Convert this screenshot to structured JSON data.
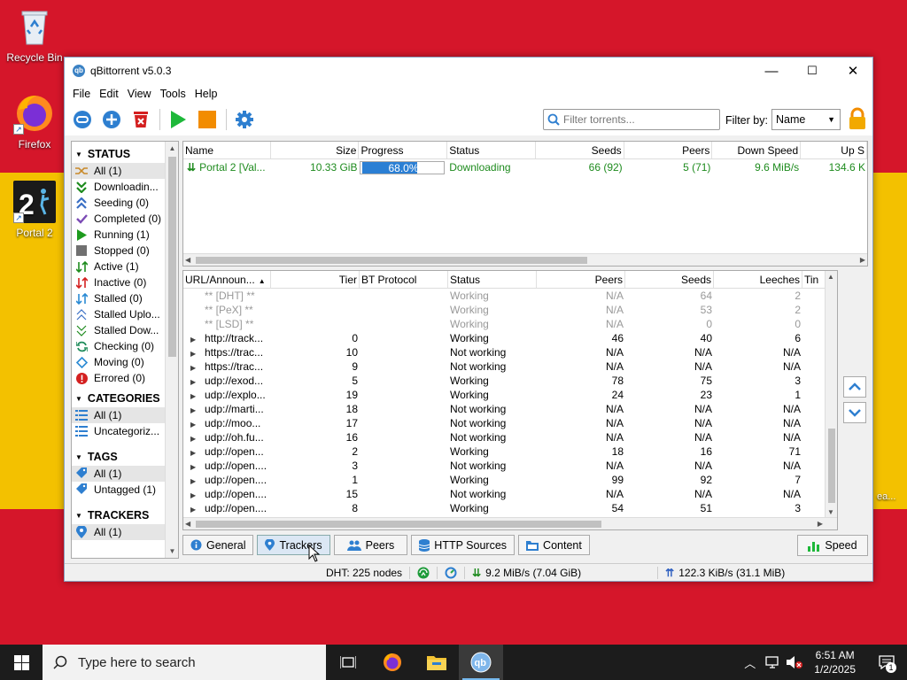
{
  "desktop": {
    "icons": [
      {
        "label": "Recycle Bin"
      },
      {
        "label": "Firefox"
      },
      {
        "label": "Portal 2"
      }
    ],
    "partial_text": "ea..."
  },
  "window": {
    "title": "qBittorrent v5.0.3",
    "controls": {
      "minimize": "—",
      "maximize": "☐",
      "close": "✕"
    }
  },
  "menu": [
    "File",
    "Edit",
    "View",
    "Tools",
    "Help"
  ],
  "toolbar": {
    "search_placeholder": "Filter torrents...",
    "filter_label": "Filter by:",
    "filter_value": "Name"
  },
  "sidebar": {
    "status": {
      "title": "STATUS",
      "items": [
        {
          "label": "All (1)",
          "icon": "shuffle-icon",
          "color": "#c98a2a"
        },
        {
          "label": "Downloadin...",
          "icon": "download-icon",
          "color": "#1e8b1e"
        },
        {
          "label": "Seeding (0)",
          "icon": "upload-icon",
          "color": "#3a6fc4"
        },
        {
          "label": "Completed (0)",
          "icon": "check-icon",
          "color": "#7b4bb5"
        },
        {
          "label": "Running (1)",
          "icon": "play-icon",
          "color": "#1e9b1e"
        },
        {
          "label": "Stopped (0)",
          "icon": "stop-icon",
          "color": "#707070"
        },
        {
          "label": "Active (1)",
          "icon": "active-arrows-icon",
          "color": "#1e8b1e"
        },
        {
          "label": "Inactive (0)",
          "icon": "inactive-arrows-icon",
          "color": "#d42020"
        },
        {
          "label": "Stalled (0)",
          "icon": "stalled-icon",
          "color": "#2a8ad4"
        },
        {
          "label": "Stalled Uplo...",
          "icon": "stalled-upload-icon",
          "color": "#3a6fc4"
        },
        {
          "label": "Stalled Dow...",
          "icon": "stalled-download-icon",
          "color": "#1e8b1e"
        },
        {
          "label": "Checking (0)",
          "icon": "checking-icon",
          "color": "#1e8b5a"
        },
        {
          "label": "Moving (0)",
          "icon": "moving-icon",
          "color": "#2a8ad4"
        },
        {
          "label": "Errored (0)",
          "icon": "error-icon",
          "color": "#d42020"
        }
      ]
    },
    "categories": {
      "title": "CATEGORIES",
      "items": [
        {
          "label": "All (1)"
        },
        {
          "label": "Uncategoriz..."
        }
      ]
    },
    "tags": {
      "title": "TAGS",
      "items": [
        {
          "label": "All (1)"
        },
        {
          "label": "Untagged (1)"
        }
      ]
    },
    "trackers": {
      "title": "TRACKERS",
      "items": [
        {
          "label": "All (1)"
        }
      ]
    }
  },
  "torrents": {
    "columns": [
      "Name",
      "Size",
      "Progress",
      "Status",
      "Seeds",
      "Peers",
      "Down Speed",
      "Up S"
    ],
    "rows": [
      {
        "name": "Portal 2 [Val...",
        "size": "10.33 GiB",
        "progress": 0.68,
        "progress_text": "68.0%",
        "status": "Downloading",
        "seeds": "66 (92)",
        "peers": "5 (71)",
        "down": "9.6 MiB/s",
        "up": "134.6 K"
      }
    ]
  },
  "trackers": {
    "columns": [
      "URL/Announ...",
      "Tier",
      "BT Protocol",
      "Status",
      "Peers",
      "Seeds",
      "Leeches",
      "Tin"
    ],
    "rows": [
      {
        "url": "** [DHT] **",
        "tier": "",
        "status": "Working",
        "peers": "N/A",
        "seeds": "64",
        "leeches": "2",
        "dim": true,
        "exp": false
      },
      {
        "url": "** [PeX] **",
        "tier": "",
        "status": "Working",
        "peers": "N/A",
        "seeds": "53",
        "leeches": "2",
        "dim": true,
        "exp": false
      },
      {
        "url": "** [LSD] **",
        "tier": "",
        "status": "Working",
        "peers": "N/A",
        "seeds": "0",
        "leeches": "0",
        "dim": true,
        "exp": false
      },
      {
        "url": "http://track...",
        "tier": "0",
        "status": "Working",
        "peers": "46",
        "seeds": "40",
        "leeches": "6",
        "dim": false,
        "exp": true
      },
      {
        "url": "https://trac...",
        "tier": "10",
        "status": "Not working",
        "peers": "N/A",
        "seeds": "N/A",
        "leeches": "N/A",
        "dim": false,
        "exp": true
      },
      {
        "url": "https://trac...",
        "tier": "9",
        "status": "Not working",
        "peers": "N/A",
        "seeds": "N/A",
        "leeches": "N/A",
        "dim": false,
        "exp": true
      },
      {
        "url": "udp://exod...",
        "tier": "5",
        "status": "Working",
        "peers": "78",
        "seeds": "75",
        "leeches": "3",
        "dim": false,
        "exp": true
      },
      {
        "url": "udp://explo...",
        "tier": "19",
        "status": "Working",
        "peers": "24",
        "seeds": "23",
        "leeches": "1",
        "dim": false,
        "exp": true
      },
      {
        "url": "udp://marti...",
        "tier": "18",
        "status": "Not working",
        "peers": "N/A",
        "seeds": "N/A",
        "leeches": "N/A",
        "dim": false,
        "exp": true
      },
      {
        "url": "udp://moo...",
        "tier": "17",
        "status": "Not working",
        "peers": "N/A",
        "seeds": "N/A",
        "leeches": "N/A",
        "dim": false,
        "exp": true
      },
      {
        "url": "udp://oh.fu...",
        "tier": "16",
        "status": "Not working",
        "peers": "N/A",
        "seeds": "N/A",
        "leeches": "N/A",
        "dim": false,
        "exp": true
      },
      {
        "url": "udp://open...",
        "tier": "2",
        "status": "Working",
        "peers": "18",
        "seeds": "16",
        "leeches": "71",
        "dim": false,
        "exp": true
      },
      {
        "url": "udp://open....",
        "tier": "3",
        "status": "Not working",
        "peers": "N/A",
        "seeds": "N/A",
        "leeches": "N/A",
        "dim": false,
        "exp": true
      },
      {
        "url": "udp://open....",
        "tier": "1",
        "status": "Working",
        "peers": "99",
        "seeds": "92",
        "leeches": "7",
        "dim": false,
        "exp": true
      },
      {
        "url": "udp://open....",
        "tier": "15",
        "status": "Not working",
        "peers": "N/A",
        "seeds": "N/A",
        "leeches": "N/A",
        "dim": false,
        "exp": true
      },
      {
        "url": "udp://open....",
        "tier": "8",
        "status": "Working",
        "peers": "54",
        "seeds": "51",
        "leeches": "3",
        "dim": false,
        "exp": true
      }
    ]
  },
  "tabs": [
    "General",
    "Trackers",
    "Peers",
    "HTTP Sources",
    "Content"
  ],
  "active_tab": "Trackers",
  "speed_button": "Speed",
  "statusbar": {
    "dht": "DHT: 225 nodes",
    "download": "9.2 MiB/s (7.04 GiB)",
    "upload": "122.3 KiB/s (31.1 MiB)"
  },
  "taskbar": {
    "search_placeholder": "Type here to search",
    "time": "6:51 AM",
    "date": "1/2/2025",
    "notification_count": "1"
  }
}
